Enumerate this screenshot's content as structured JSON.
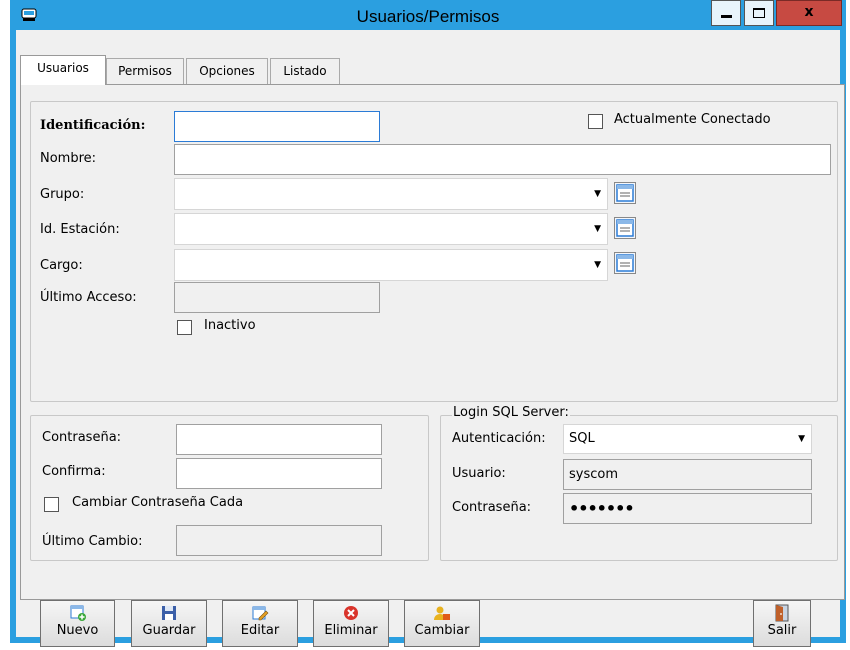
{
  "window": {
    "title": "Usuarios/Permisos",
    "close_glyph": "x"
  },
  "tabs": [
    {
      "label": "Usuarios",
      "active": true
    },
    {
      "label": "Permisos",
      "active": false
    },
    {
      "label": "Opciones",
      "active": false
    },
    {
      "label": "Listado",
      "active": false
    }
  ],
  "user": {
    "id_label": "Identificación:",
    "id_value": "",
    "connected_label": "Actualmente Conectado",
    "connected_checked": false,
    "name_label": "Nombre:",
    "name_value": "",
    "group_label": "Grupo:",
    "group_value": "",
    "station_label": "Id. Estación:",
    "station_value": "",
    "position_label": "Cargo:",
    "position_value": "",
    "last_access_label": "Último Acceso:",
    "last_access_value": "",
    "inactive_label": "Inactivo",
    "inactive_checked": false
  },
  "password": {
    "password_label": "Contraseña:",
    "confirm_label": "Confirma:",
    "change_every_label": "Cambiar Contraseña Cada",
    "last_change_label": "Último Cambio:"
  },
  "sql_login": {
    "legend": "Login SQL Server:",
    "auth_label": "Autenticación:",
    "auth_value": "SQL",
    "user_label": "Usuario:",
    "user_value": "syscom",
    "password_label": "Contraseña:",
    "password_masked": "•••••••"
  },
  "toolbar": {
    "new_label": "Nuevo",
    "save_label": "Guardar",
    "edit_label": "Editar",
    "delete_label": "Eliminar",
    "change_label": "Cambiar",
    "exit_label": "Salir"
  },
  "colors": {
    "title_bar": "#2b9fe0",
    "close_button": "#c74a42",
    "panel": "#f0f0f0"
  }
}
